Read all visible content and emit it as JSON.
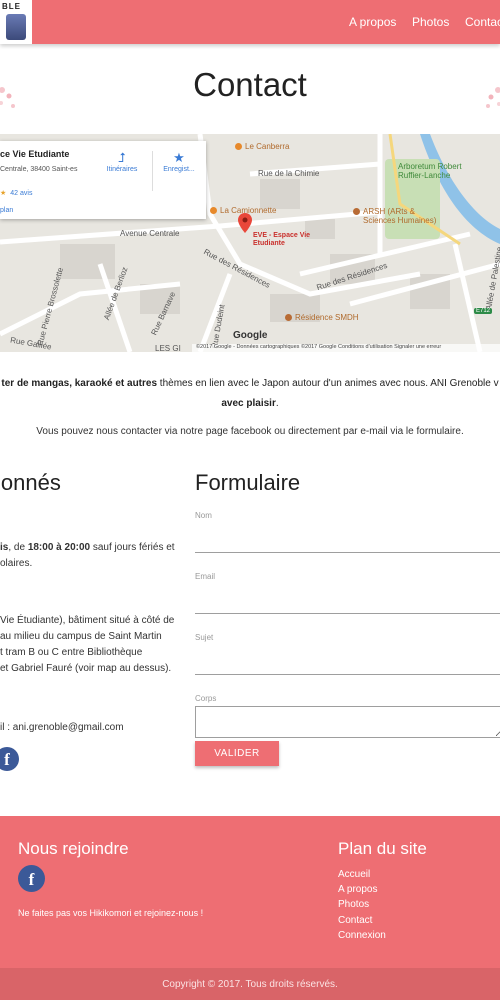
{
  "header": {
    "logo_text": "BLE",
    "nav": [
      "A propos",
      "Photos",
      "Contact"
    ]
  },
  "page": {
    "title": "Contact"
  },
  "map": {
    "card": {
      "title": "ce Vie Etudiante",
      "address": "Centrale, 38400 Saint-es",
      "stars": "★",
      "reviews": "42 avis",
      "plan_link": "plan",
      "directions": "Itinéraires",
      "save": "Enregist..."
    },
    "labels": {
      "canberra": "Le Canberra",
      "chimie": "Rue de la Chimie",
      "arboretum": "Arboretum Robert Ruffier-Lanche",
      "camionnette": "La Camionnette",
      "arsh": "ARSH (ARts & Sciences Humaines)",
      "avenue_centrale": "Avenue Centrale",
      "eve": "EVE - Espace Vie Etudiante",
      "residences1": "Rue des Résidences",
      "residences2": "Rue des Résidences",
      "residence_smdh": "Résidence SMDH",
      "berlioz": "Allée de Berlioz",
      "barnave": "Rue Barnave",
      "dudeint": "Rue Dudeint",
      "brossolette": "Rue Pierre Brossolette",
      "galilee": "Rue Galilée",
      "palestine": "Allée de Palestine",
      "route": "E712",
      "les": "LES GI"
    },
    "google": "Google",
    "footer_text": "©2017 Google - Données cartographiques ©2017 Google     Conditions d'utilisation     Signaler une erreur"
  },
  "intro": {
    "bold_1": "ter de mangas, karaoké et autres",
    "text_1": " thèmes en lien avec le Japon autour d'un animes avec nous. ANI Grenoble v",
    "bold_2": "avec plaisir",
    "text_2": "."
  },
  "contact_line": "Vous pouvez nous contacter via notre page facebook ou directement par e-mail via le formulaire.",
  "infos": {
    "heading": "lonnés",
    "hours_bold_day": "is",
    "hours_mid": ", de ",
    "hours_bold_time": "18:00 à 20:00",
    "hours_rest": " sauf jours fériés et",
    "hours_line2": "olaires.",
    "place_1": "Vie Étudiante), bâtiment situé à côté de",
    "place_2": "au milieu du campus de Saint Martin",
    "place_3": "t tram B ou C entre Bibliothèque",
    "place_4": "et Gabriel Fauré (voir map au dessus).",
    "email": "il : ani.grenoble@gmail.com",
    "fb_letter": "f"
  },
  "form": {
    "heading": "Formulaire",
    "name_label": "Nom",
    "email_label": "Email",
    "subject_label": "Sujet",
    "body_label": "Corps",
    "submit": "VALIDER"
  },
  "footer": {
    "join_heading": "Nous rejoindre",
    "fb_letter": "f",
    "join_text": "Ne faites pas vos Hikikomori et rejoinez-nous !",
    "sitemap_heading": "Plan du site",
    "sitemap": [
      "Accueil",
      "A propos",
      "Photos",
      "Contact",
      "Connexion"
    ],
    "copyright": "Copyright © 2017. Tous droits réservés."
  },
  "colors": {
    "primary": "#ee6e73",
    "copyright_bar": "#d96468",
    "facebook": "#3b5998",
    "map_water": "#8fc2e8",
    "map_park": "#c8dfb5"
  },
  "icons": {
    "directions": "directions-icon",
    "save": "star-icon",
    "map_pin": "map-pin-icon",
    "facebook": "facebook-icon"
  }
}
